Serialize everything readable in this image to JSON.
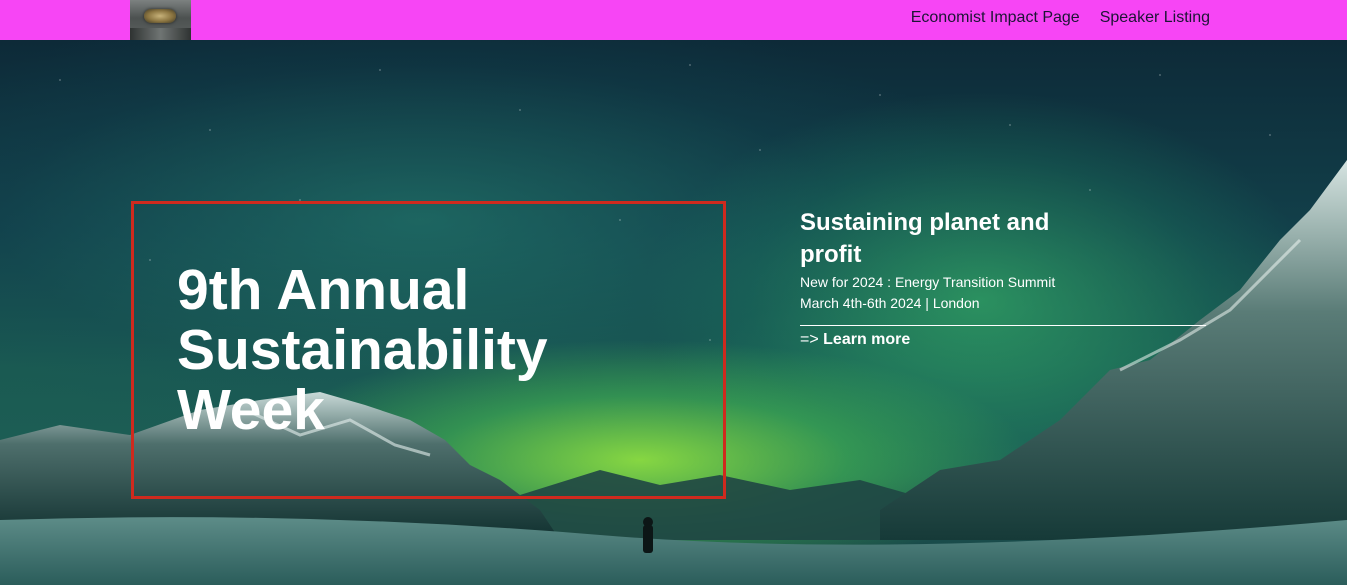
{
  "nav": {
    "logo_alt": "logo",
    "links": [
      {
        "label": "Economist Impact Page"
      },
      {
        "label": "Speaker Listing"
      }
    ],
    "background_color": "#f745f5"
  },
  "hero": {
    "title": "9th Annual Sustainability Week",
    "title_lines": [
      "9th Annual",
      "Sustainability",
      "Week"
    ],
    "box_border_color": "#cf2a1e",
    "background_image": "northern-lights-mountains"
  },
  "info": {
    "heading": "Sustaining planet and profit",
    "subline_1": "New for 2024 : Energy Transition Summit",
    "subline_2": "March 4th-6th 2024 | London",
    "cta_arrow": "=>",
    "cta_label": "Learn more"
  }
}
